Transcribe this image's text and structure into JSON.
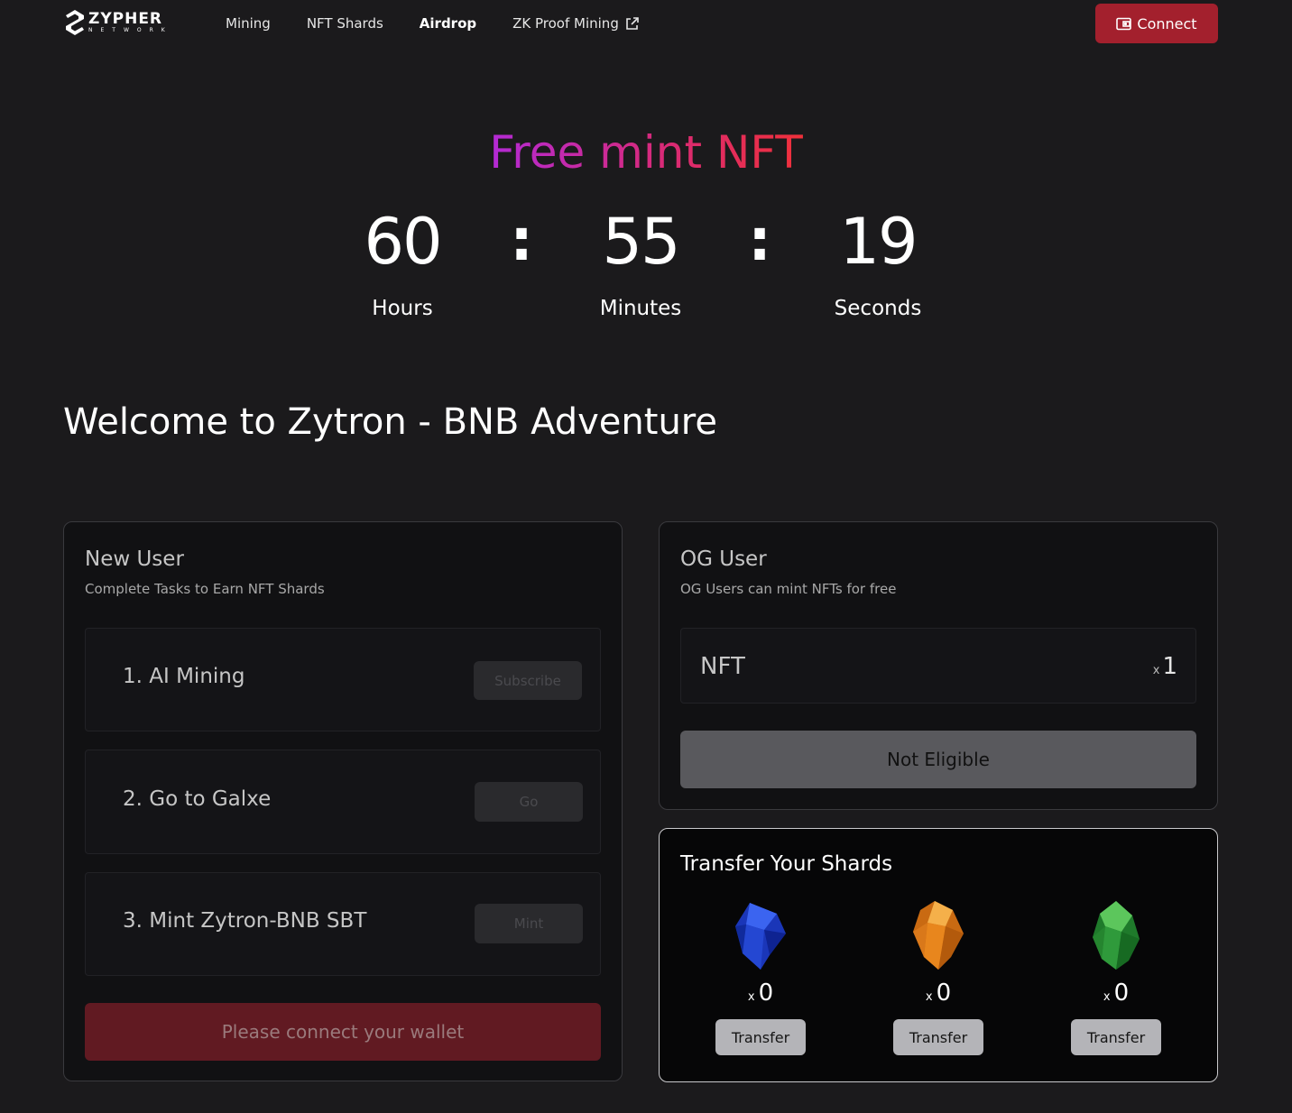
{
  "header": {
    "logo_word": "ZYPHER",
    "logo_sub": "NETWORK",
    "nav": [
      {
        "label": "Mining"
      },
      {
        "label": "NFT Shards"
      },
      {
        "label": "Airdrop",
        "active": true
      },
      {
        "label": "ZK Proof Mining",
        "external": true
      }
    ],
    "connect_label": "Connect"
  },
  "hero": {
    "title": "Free mint NFT",
    "countdown": {
      "hours": "60",
      "minutes": "55",
      "seconds": "19",
      "separator": ":",
      "hours_label": "Hours",
      "minutes_label": "Minutes",
      "seconds_label": "Seconds"
    }
  },
  "welcome": "Welcome to Zytron - BNB Adventure",
  "new_user": {
    "title": "New User",
    "subtitle": "Complete Tasks to Earn NFT Shards",
    "tasks": [
      {
        "label": "1. AI Mining",
        "button": "Subscribe"
      },
      {
        "label": "2. Go to Galxe",
        "button": "Go"
      },
      {
        "label": "3. Mint Zytron-BNB SBT",
        "button": "Mint"
      }
    ],
    "wallet_button": "Please connect your wallet"
  },
  "og_user": {
    "title": "OG User",
    "subtitle": "OG Users can mint NFTs for free",
    "nft_label": "NFT",
    "nft_qty_prefix": "x",
    "nft_qty": "1",
    "eligibility_button": "Not Eligible"
  },
  "transfer": {
    "title": "Transfer Your Shards",
    "shards": [
      {
        "icon": "blue-shard-icon",
        "color": "#1b3fd6",
        "prefix": "x",
        "count": "0",
        "button": "Transfer"
      },
      {
        "icon": "orange-shard-icon",
        "color": "#e8861d",
        "prefix": "x",
        "count": "0",
        "button": "Transfer"
      },
      {
        "icon": "green-shard-icon",
        "color": "#2f9a3b",
        "prefix": "x",
        "count": "0",
        "button": "Transfer"
      }
    ]
  },
  "colors": {
    "background": "#1b1a1c",
    "accent": "#a3202d",
    "title_gradient": [
      "#b32ad6",
      "#d82a78",
      "#f0303a"
    ]
  }
}
